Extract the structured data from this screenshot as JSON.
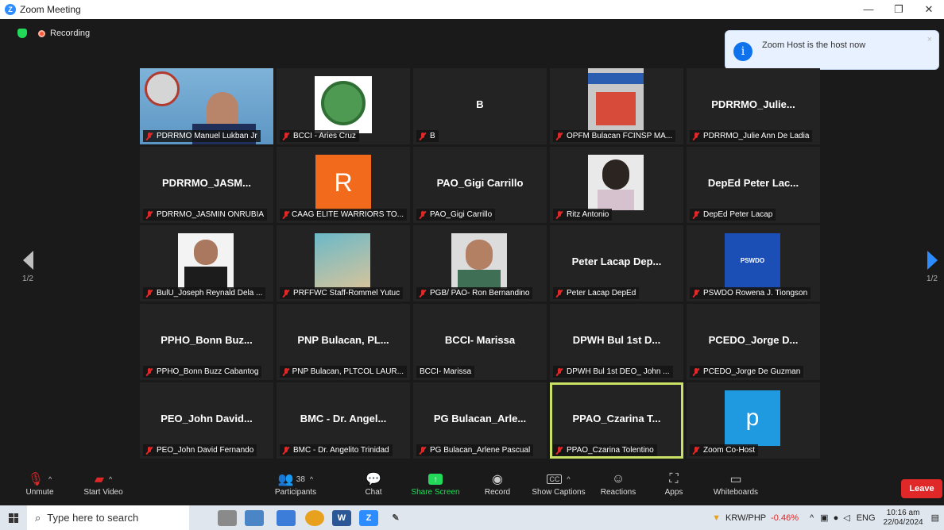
{
  "window": {
    "title": "Zoom Meeting",
    "controls": [
      "—",
      "❐",
      "✕"
    ]
  },
  "status": {
    "recording": "Recording"
  },
  "toast": {
    "message": "Zoom Host is the host now",
    "close": "×"
  },
  "pager": {
    "left": "1/2",
    "right": "1/2"
  },
  "tiles": [
    {
      "big": "",
      "name": "PDRRMO Manuel Lukban Jr",
      "muted": true
    },
    {
      "big": "",
      "name": "BCCI - Aries Cruz",
      "muted": true
    },
    {
      "big": "B",
      "name": "B",
      "muted": true
    },
    {
      "big": "",
      "name": "OPFM Bulacan FCINSP MA...",
      "muted": true
    },
    {
      "big": "PDRRMO_Julie...",
      "name": "PDRRMO_Julie Ann De Ladia",
      "muted": true
    },
    {
      "big": "PDRRMO_JASM...",
      "name": "PDRRMO_JASMIN ONRUBIA",
      "muted": true
    },
    {
      "big": "",
      "name": "CAAG ELITE WARRIORS TO...",
      "muted": true,
      "avatar": "R"
    },
    {
      "big": "PAO_Gigi Carrillo",
      "name": "PAO_Gigi Carrillo",
      "muted": true
    },
    {
      "big": "",
      "name": "Ritz Antonio",
      "muted": true
    },
    {
      "big": "DepEd Peter Lac...",
      "name": "DepEd Peter Lacap",
      "muted": true
    },
    {
      "big": "",
      "name": "BulU_Joseph Reynald Dela ...",
      "muted": true
    },
    {
      "big": "",
      "name": "PRFFWC Staff-Rommel Yutuc",
      "muted": true
    },
    {
      "big": "",
      "name": "PGB/ PAO- Ron Bernandino",
      "muted": true
    },
    {
      "big": "Peter Lacap Dep...",
      "name": "Peter Lacap DepEd",
      "muted": true
    },
    {
      "big": "",
      "name": "PSWDO Rowena J. Tiongson",
      "muted": true,
      "logo": "PSWDO"
    },
    {
      "big": "PPHO_Bonn Buz...",
      "name": "PPHO_Bonn Buzz Cabantog",
      "muted": true
    },
    {
      "big": "PNP Bulacan, PL...",
      "name": "PNP Bulacan, PLTCOL LAUR...",
      "muted": true
    },
    {
      "big": "BCCI- Marissa",
      "name": "BCCI- Marissa",
      "muted": false
    },
    {
      "big": "DPWH Bul 1st D...",
      "name": "DPWH Bul 1st DEO_ John ...",
      "muted": true
    },
    {
      "big": "PCEDO_Jorge D...",
      "name": "PCEDO_Jorge De Guzman",
      "muted": true
    },
    {
      "big": "PEO_John David...",
      "name": "PEO_John David Fernando",
      "muted": true
    },
    {
      "big": "BMC - Dr. Angel...",
      "name": "BMC - Dr. Angelito Trinidad",
      "muted": true
    },
    {
      "big": "PG Bulacan_Arle...",
      "name": "PG Bulacan_Arlene Pascual",
      "muted": true
    },
    {
      "big": "PPAO_Czarina T...",
      "name": "PPAO_Czarina Tolentino",
      "muted": true,
      "active": true
    },
    {
      "big": "",
      "name": "Zoom Co-Host",
      "muted": true,
      "avatar": "p"
    }
  ],
  "toolbar": {
    "unmute": "Unmute",
    "start_video": "Start Video",
    "participants": "Participants",
    "participants_count": "38",
    "chat": "Chat",
    "share_screen": "Share Screen",
    "record": "Record",
    "show_captions": "Show Captions",
    "captions_icon": "CC",
    "reactions": "Reactions",
    "apps": "Apps",
    "whiteboards": "Whiteboards",
    "leave": "Leave"
  },
  "taskbar": {
    "search_placeholder": "Type here to search",
    "currency": "KRW/PHP",
    "currency_change": "-0.46%",
    "language": "ENG",
    "time": "10:16 am",
    "date": "22/04/2024"
  },
  "colors": {
    "accent": "#2d8cff",
    "leave": "#e02828",
    "active_border": "#c9e265",
    "share": "#23d959",
    "negative": "#e02828"
  }
}
